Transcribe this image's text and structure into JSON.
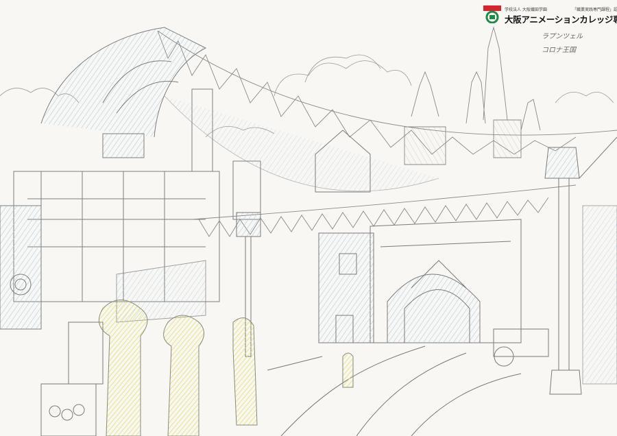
{
  "header": {
    "subtitle": "学校法人 大阪織田学園",
    "badge": "「職業実践専門課程」認定校",
    "school_name": "大阪アニメーションカレッジ専門学校"
  },
  "note": {
    "line1": "ラプンツェル",
    "line2": "コロナ王国"
  },
  "colors": {
    "pencil": "#7b7b7b",
    "blue_pencil": "#9cc3e0",
    "yellow_pencil": "#e8e27a",
    "logo_green": "#1e8a4a",
    "logo_red": "#d8252d"
  }
}
